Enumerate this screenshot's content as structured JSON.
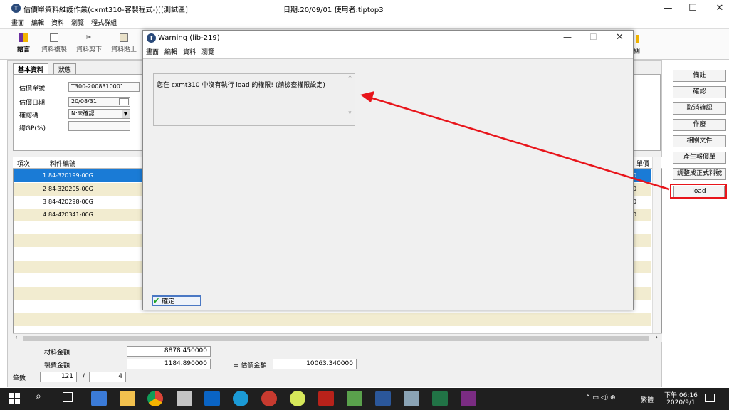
{
  "window": {
    "title": "估價單資料維護作業(cxmt310-客製程式-)[[測試區]",
    "info": "日期:20/09/01   使用者:tiptop3",
    "icon_name": "tiptop-app-icon"
  },
  "menubar": [
    "畫面",
    "編輯",
    "資料",
    "瀏覽",
    "程式群組"
  ],
  "toolbar": [
    {
      "label": "語言",
      "icon": "flag-icon"
    },
    {
      "label": "資料複製",
      "icon": "copy-icon"
    },
    {
      "label": "資料剪下",
      "icon": "cut-icon"
    },
    {
      "label": "資料貼上",
      "icon": "paste-icon"
    }
  ],
  "toolbar_right_fragment": "關",
  "tabs": [
    "基本資料",
    "狀態"
  ],
  "form": {
    "quote_no_label": "估價單號",
    "quote_no_value": "T300-2008310001",
    "quote_date_label": "估價日期",
    "quote_date_value": "20/08/31",
    "confirm_label": "確認碼",
    "confirm_value": "N:未確認",
    "gp_label": "總GP(%)",
    "gp_value": ""
  },
  "grid": {
    "col_item": "項次",
    "col_part": "料件編號",
    "col_right": "單價",
    "rows": [
      {
        "item": "1",
        "part": "84-320199-00G",
        "right": "0"
      },
      {
        "item": "2",
        "part": "84-320205-00G",
        "right": "0"
      },
      {
        "item": "3",
        "part": "84-420298-00G",
        "right": "0"
      },
      {
        "item": "4",
        "part": "84-420341-00G",
        "right": "0"
      }
    ]
  },
  "side_buttons": [
    "備註",
    "確認",
    "取消確認",
    "作廢",
    "相關文件",
    "產生報價單",
    "調整成正式料號",
    "load"
  ],
  "highlight_color": "#e8151b",
  "bottom": {
    "material_label": "材料金額",
    "material_value": "8878.450000",
    "mfg_label": "製費金額",
    "mfg_value": "1184.890000",
    "quote_amount_label": "= 估價金額",
    "quote_amount_value": "10063.340000",
    "count_label": "筆數",
    "count_value": "121",
    "count_sep": "/",
    "count_total": "4"
  },
  "dialog": {
    "title": "Warning (lib-219)",
    "menu": [
      "畫面",
      "編輯",
      "資料",
      "瀏覽"
    ],
    "message": "您在 cxmt310 中沒有執行 load 的權限! (請檢查權限設定)",
    "ok_label": "確定"
  },
  "taskbar": {
    "ime": "繁體",
    "time": "下午 06:16",
    "date": "2020/9/1"
  }
}
